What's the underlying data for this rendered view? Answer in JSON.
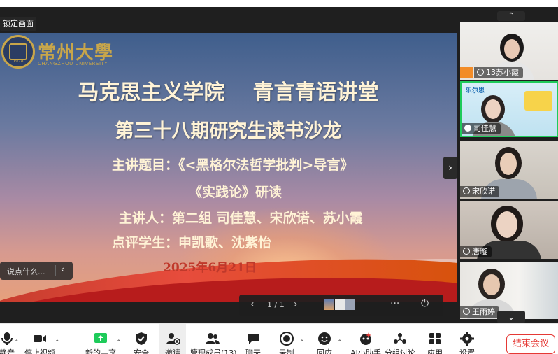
{
  "stage": {
    "lock_label": "锁定画面"
  },
  "slide": {
    "university_cn": "常州大學",
    "university_en": "CHANGZHOU UNIVERSITY",
    "founded": "1978",
    "title_left": "马克思主义学院",
    "title_right": "青言青语讲堂",
    "subtitle": "第三十八期研究生读书沙龙",
    "topic": "主讲题目：《<黑格尔法哲学批判>导言》",
    "topic2": "《实践论》研读",
    "speakers": "主讲人：第二组   司佳慧、宋欣诺、苏小霞",
    "reviewers": "点评学生：申凯歌、沈紫怡",
    "date": "2025年6月21日"
  },
  "chat": {
    "placeholder": "说点什么..."
  },
  "slide_controls": {
    "page": "1 / 1"
  },
  "participants": [
    {
      "name": "13苏小霞",
      "host": true,
      "active": false
    },
    {
      "name": "司佳慧",
      "host": false,
      "active": true,
      "bg_text": "乐尔思"
    },
    {
      "name": "宋欣诺",
      "host": false,
      "active": false
    },
    {
      "name": "唐璇",
      "host": false,
      "active": false
    },
    {
      "name": "王雨婷",
      "host": false,
      "active": false
    }
  ],
  "toolbar": {
    "items": [
      {
        "label": "静音",
        "icon": "mic-icon"
      },
      {
        "label": "停止视频",
        "icon": "video-icon"
      },
      {
        "label": "新的共享",
        "icon": "share-icon"
      },
      {
        "label": "安全",
        "icon": "shield-icon"
      },
      {
        "label": "邀请",
        "icon": "invite-icon"
      },
      {
        "label": "管理成员(13)",
        "icon": "members-icon"
      },
      {
        "label": "聊天",
        "icon": "chat-icon"
      },
      {
        "label": "录制",
        "icon": "record-icon"
      },
      {
        "label": "回应",
        "icon": "reaction-icon"
      },
      {
        "label": "AI小助手",
        "icon": "ai-assistant-icon"
      },
      {
        "label": "分组讨论",
        "icon": "breakout-icon"
      },
      {
        "label": "应用",
        "icon": "apps-icon"
      },
      {
        "label": "设置",
        "icon": "gear-icon"
      }
    ],
    "end_label": "结束会议"
  },
  "colors": {
    "accent_green": "#1ecb5a",
    "end_red": "#e53935",
    "slide_gold": "#c8a64a"
  }
}
